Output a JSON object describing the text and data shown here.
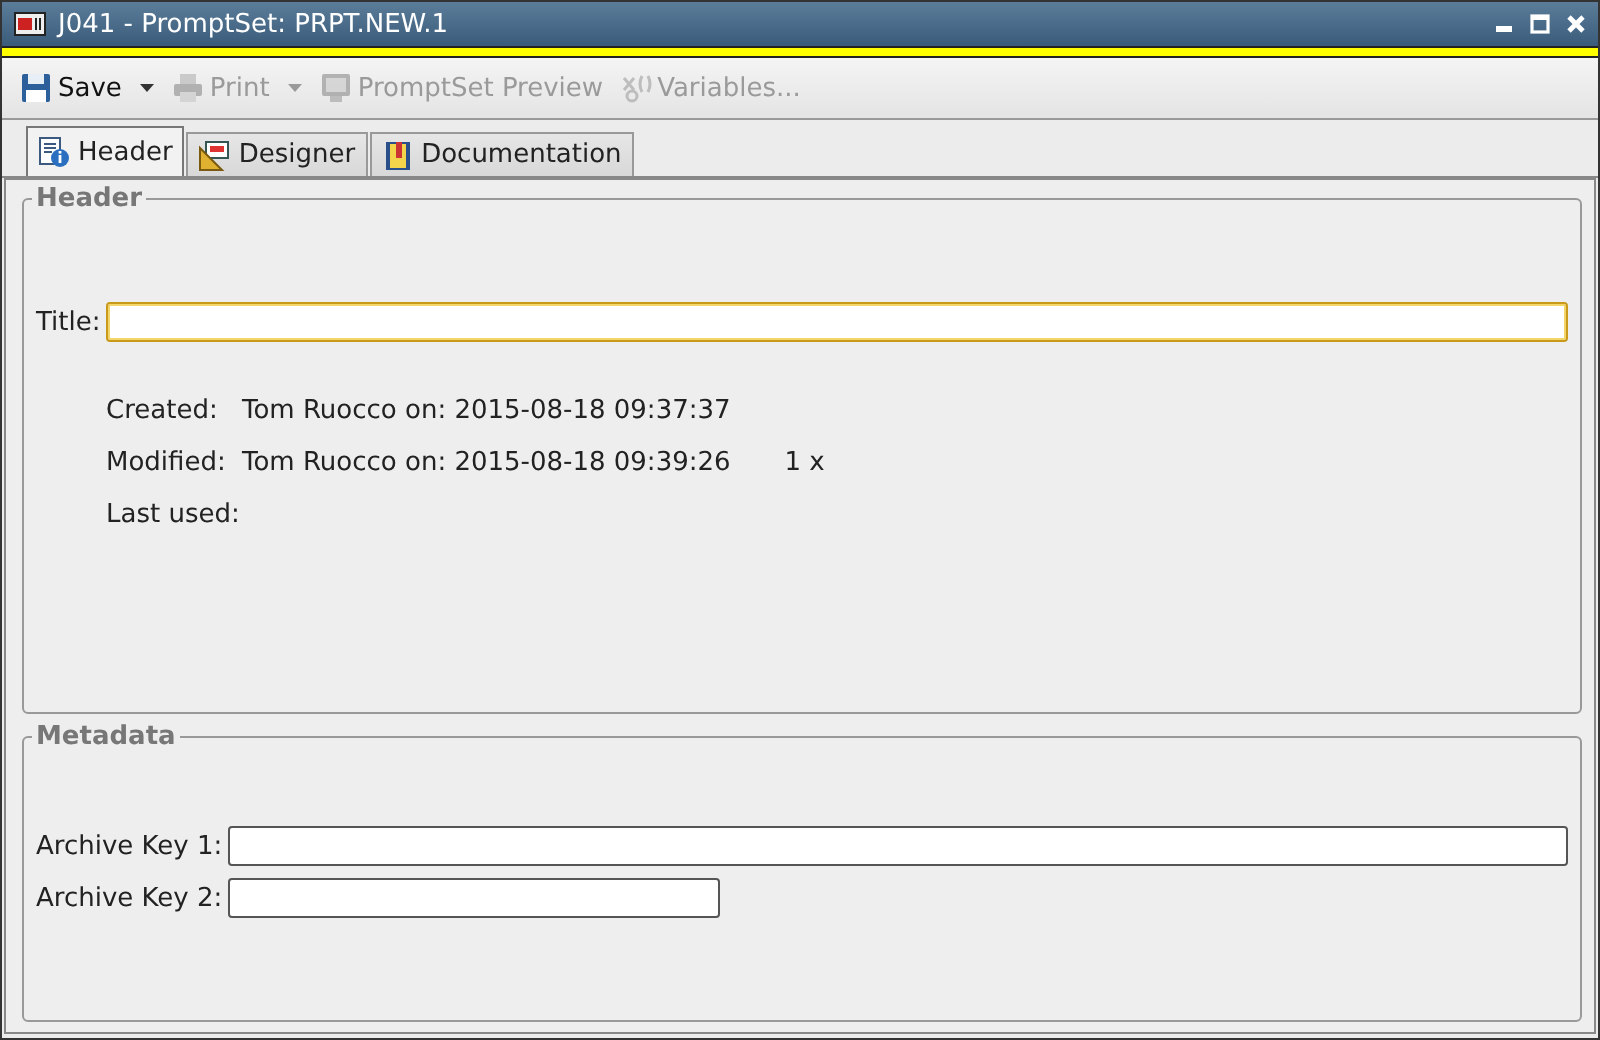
{
  "window": {
    "title": "J041 - PromptSet: PRPT.NEW.1"
  },
  "toolbar": [
    {
      "label": "Save",
      "disabled": false,
      "has_menu": true
    },
    {
      "label": "Print",
      "disabled": true,
      "has_menu": true
    },
    {
      "label": "PromptSet Preview",
      "disabled": true,
      "has_menu": false
    },
    {
      "label": "Variables...",
      "disabled": true,
      "has_menu": false
    }
  ],
  "tabs": [
    {
      "label": "Header",
      "selected": true
    },
    {
      "label": "Designer",
      "selected": false
    },
    {
      "label": "Documentation",
      "selected": false
    }
  ],
  "header": {
    "title": "Header",
    "title_field": {
      "label": "Title:",
      "focused": true
    },
    "info": [
      {
        "label": "Created:",
        "value": "Tom Ruocco on: 2015-08-18 09:37:37"
      },
      {
        "label": "Modified:",
        "value": "Tom Ruocco on: 2015-08-18 09:39:26",
        "count": "1 x"
      },
      {
        "label": "Last used:"
      }
    ]
  },
  "metadata": {
    "title": "Metadata",
    "fields": [
      {
        "label": "Archive Key 1:"
      },
      {
        "label": "Archive Key 2:"
      }
    ]
  }
}
